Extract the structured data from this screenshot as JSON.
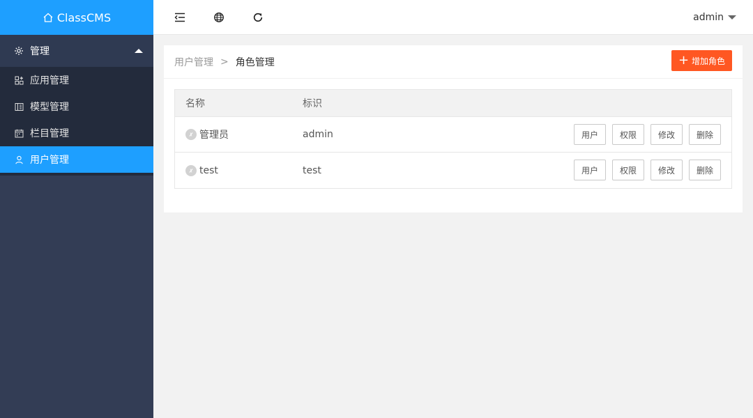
{
  "app": {
    "title": "ClassCMS"
  },
  "sidebar": {
    "group": {
      "label": "管理",
      "icon": "gear-icon"
    },
    "items": [
      {
        "label": "应用管理",
        "icon": "apps-icon",
        "active": false
      },
      {
        "label": "模型管理",
        "icon": "model-icon",
        "active": false
      },
      {
        "label": "栏目管理",
        "icon": "calendar-icon",
        "active": false
      },
      {
        "label": "用户管理",
        "icon": "user-icon",
        "active": true
      }
    ]
  },
  "header": {
    "icons": [
      "collapse-menu-icon",
      "globe-icon",
      "refresh-icon"
    ],
    "user": "admin"
  },
  "breadcrumb": {
    "parent": "用户管理",
    "separator": ">",
    "current": "角色管理"
  },
  "add_button": {
    "label": "增加角色"
  },
  "table": {
    "headers": [
      "名称",
      "标识"
    ],
    "rows": [
      {
        "name": "管理员",
        "id": "admin"
      },
      {
        "name": "test",
        "id": "test"
      }
    ],
    "actions": [
      "用户",
      "权限",
      "修改",
      "删除"
    ]
  },
  "colors": {
    "brand": "#1e9fff",
    "sidebar": "#333d55",
    "danger": "#ff5722"
  }
}
